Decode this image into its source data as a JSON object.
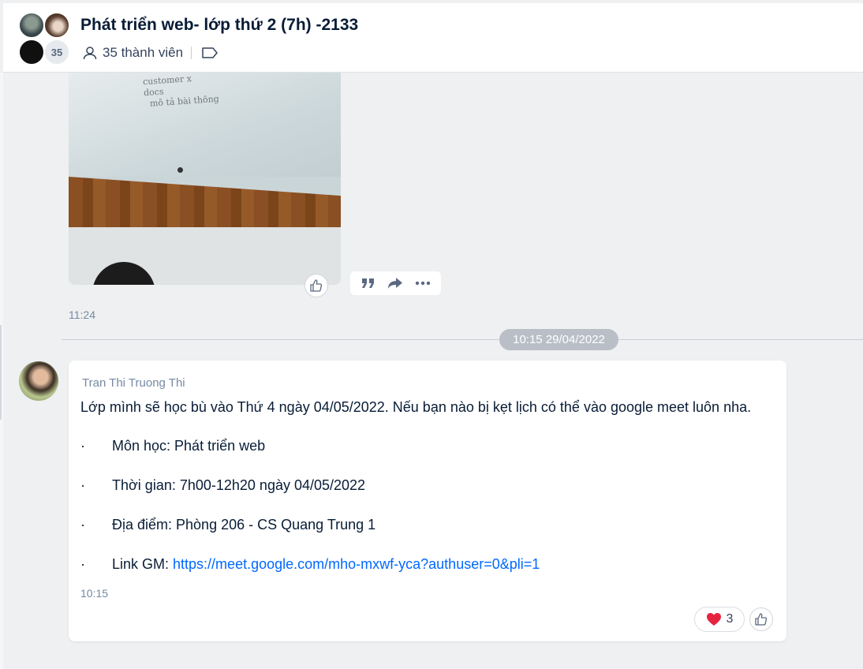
{
  "header": {
    "title": "Phát triển web- lớp thứ 2 (7h) -2133",
    "avatar_count": "35",
    "members_label": "35 thành viên",
    "icons": [
      "person-icon",
      "tag-icon"
    ]
  },
  "image_message": {
    "time": "11:24",
    "actions": [
      "quote-icon",
      "share-icon",
      "more-icon",
      "like-icon"
    ],
    "photo_note": "customer x\ndocs\n  mô tả bài thông"
  },
  "divider": {
    "date": "10:15 29/04/2022"
  },
  "text_message": {
    "sender": "Tran Thi Truong Thi",
    "intro": "Lớp mình sẽ học bù vào Thứ 4 ngày 04/05/2022. Nếu bạn nào bị kẹt lịch có thể vào google meet luôn nha.",
    "bullet_char": "·",
    "items": [
      "Môn học: Phát triển web",
      "Thời gian: 7h00-12h20 ngày 04/05/2022",
      "Địa điểm: Phòng 206 - CS Quang Trung 1"
    ],
    "link_label": "Link GM: ",
    "link_url": "https://meet.google.com/mho-mxwf-yca?authuser=0&pli=1",
    "time": "10:15",
    "reaction": {
      "icon": "heart-icon",
      "count": "3"
    }
  },
  "colors": {
    "accent": "#0068ff",
    "heart": "#e5243f",
    "divider_pill": "#b9bec7"
  }
}
